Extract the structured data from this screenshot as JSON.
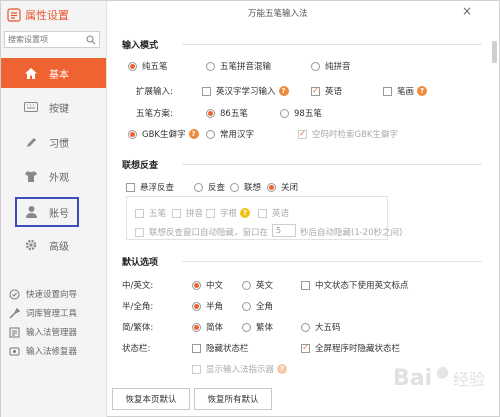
{
  "sidebar": {
    "title": "属性设置",
    "search_placeholder": "搜索设置项",
    "nav": [
      {
        "label": "基本",
        "icon": "home-icon"
      },
      {
        "label": "按键",
        "icon": "keyboard-icon"
      },
      {
        "label": "习惯",
        "icon": "pencil-icon"
      },
      {
        "label": "外观",
        "icon": "shirt-icon"
      },
      {
        "label": "账号",
        "icon": "user-icon"
      },
      {
        "label": "高级",
        "icon": "gear-icon"
      }
    ],
    "tools": [
      {
        "label": "快速设置向导",
        "icon": "wizard-icon"
      },
      {
        "label": "词库管理工具",
        "icon": "tool-icon"
      },
      {
        "label": "输入法管理器",
        "icon": "manager-icon"
      },
      {
        "label": "输入法修复器",
        "icon": "repair-icon"
      }
    ]
  },
  "window": {
    "title": "万能五笔输入法",
    "close": "×"
  },
  "input_mode": {
    "section": "输入模式",
    "modes": [
      "纯五笔",
      "五笔拼音混输",
      "纯拼音"
    ],
    "ext_label": "扩展输入:",
    "ext_items": [
      "英汉字学习输入",
      "英语",
      "笔画"
    ],
    "scheme_label": "五笔方案:",
    "schemes": [
      "86五笔",
      "98五笔"
    ],
    "charset": [
      "GBK生僻字",
      "常用汉字"
    ],
    "empty_check": "空码时检索GBK生僻字"
  },
  "reverse": {
    "section": "联想反查",
    "float": "悬浮反查",
    "options": [
      "反查",
      "联想",
      "关闭"
    ],
    "sub_items": [
      "五笔",
      "拼音",
      "字根",
      "英语"
    ],
    "auto_hide_pre": "联想反查窗口自动隐藏，窗口在",
    "auto_hide_val": "5",
    "auto_hide_post": "秒后自动隐藏(1-20秒之间)"
  },
  "defaults": {
    "section": "默认选项",
    "rows": [
      {
        "label": "中/英文:",
        "opts": [
          "中文",
          "英文"
        ],
        "check": "中文状态下使用英文标点"
      },
      {
        "label": "半/全角:",
        "opts": [
          "半角",
          "全角"
        ]
      },
      {
        "label": "简/繁体:",
        "opts": [
          "简体",
          "繁体",
          "大五码"
        ]
      },
      {
        "label": "状态栏:",
        "checks": [
          "隐藏状态栏",
          "全屏程序时隐藏状态栏"
        ]
      }
    ],
    "indicator": "显示输入法指示器"
  },
  "buttons": {
    "restore_page": "恢复本页默认",
    "restore_all": "恢复所有默认"
  },
  "watermark": "Bai 经验",
  "colors": {
    "accent": "#ee6331",
    "nav_highlight": "#3d4db8"
  }
}
